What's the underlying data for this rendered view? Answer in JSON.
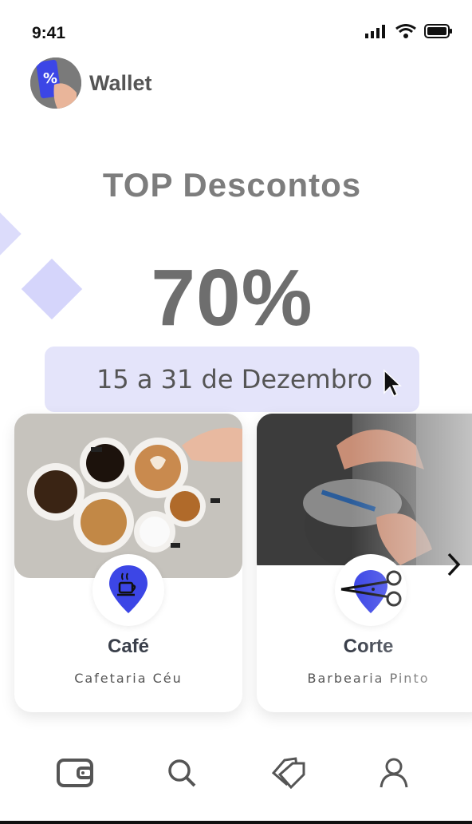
{
  "status_bar": {
    "time": "9:41",
    "icons": [
      "signal-icon",
      "wifi-icon",
      "battery-icon"
    ]
  },
  "header": {
    "title": "Wallet",
    "avatar_icon": "phone-discount-icon"
  },
  "promo": {
    "title": "TOP Descontos",
    "discount": "70%",
    "date_range": "15 a 31 de Dezembro"
  },
  "cards": [
    {
      "title": "Café",
      "subtitle": "Cafetaria Céu",
      "icon": "coffee-cup-icon",
      "photo": "coffee-cups-photo"
    },
    {
      "title": "Corte",
      "subtitle": "Barbearia Pinto",
      "icon": "scissors-icon",
      "photo": "barber-haircut-photo"
    }
  ],
  "carousel": {
    "next_icon": "chevron-right-icon"
  },
  "bottom_nav": [
    {
      "name": "wallet",
      "icon": "wallet-icon"
    },
    {
      "name": "search",
      "icon": "search-icon"
    },
    {
      "name": "coupons",
      "icon": "tags-icon"
    },
    {
      "name": "profile",
      "icon": "user-icon"
    }
  ],
  "colors": {
    "accent": "#3c46e6",
    "pill": "#e4e4fa",
    "diamond": "#d5d5fb"
  }
}
